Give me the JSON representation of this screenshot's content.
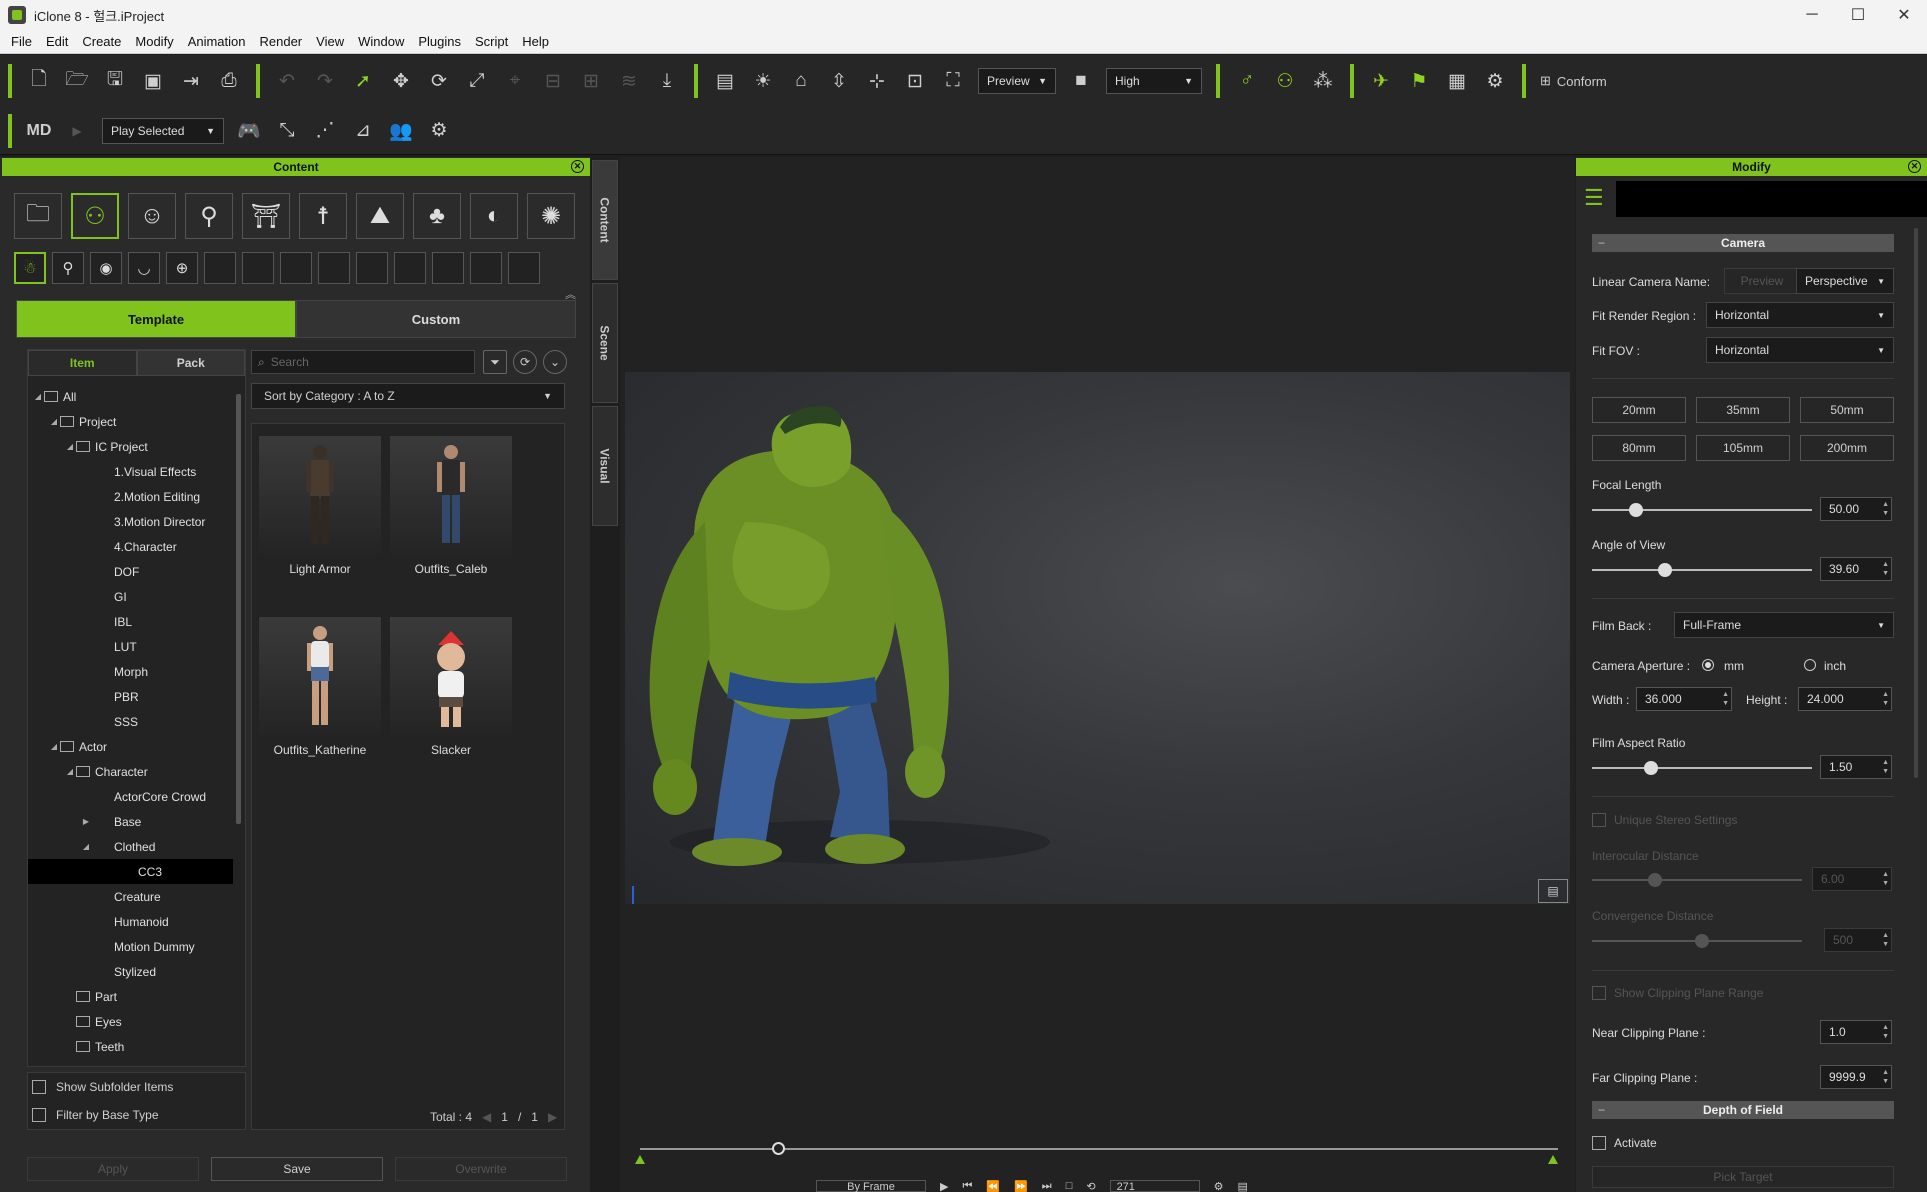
{
  "window": {
    "title": "iClone 8 - 헐크.iProject"
  },
  "menu": [
    "File",
    "Edit",
    "Create",
    "Modify",
    "Animation",
    "Render",
    "View",
    "Window",
    "Plugins",
    "Script",
    "Help"
  ],
  "toolbar": {
    "preview_mode": "Preview",
    "quality": "High",
    "conform_label": "Conform"
  },
  "toolbar2": {
    "play_mode": "Play Selected"
  },
  "content": {
    "title": "Content",
    "tabs": {
      "template": "Template",
      "custom": "Custom"
    },
    "subtabs": {
      "item": "Item",
      "pack": "Pack"
    },
    "search_placeholder": "Search",
    "sort": "Sort by Category : A to Z",
    "tree": [
      {
        "label": "All",
        "indent": 0,
        "toggle": "◢",
        "folder": true
      },
      {
        "label": "Project",
        "indent": 1,
        "toggle": "◢",
        "folder": true
      },
      {
        "label": "IC Project",
        "indent": 2,
        "toggle": "◢",
        "folder": true
      },
      {
        "label": "1.Visual Effects",
        "indent": 3
      },
      {
        "label": "2.Motion Editing",
        "indent": 3
      },
      {
        "label": "3.Motion Director",
        "indent": 3
      },
      {
        "label": "4.Character",
        "indent": 3
      },
      {
        "label": "DOF",
        "indent": 3
      },
      {
        "label": "GI",
        "indent": 3
      },
      {
        "label": "IBL",
        "indent": 3
      },
      {
        "label": "LUT",
        "indent": 3
      },
      {
        "label": "Morph",
        "indent": 3
      },
      {
        "label": "PBR",
        "indent": 3
      },
      {
        "label": "SSS",
        "indent": 3
      },
      {
        "label": "Actor",
        "indent": 1,
        "toggle": "◢",
        "folder": true
      },
      {
        "label": "Character",
        "indent": 2,
        "toggle": "◢",
        "folder": true
      },
      {
        "label": "ActorCore Crowd",
        "indent": 3
      },
      {
        "label": "Base",
        "indent": 3,
        "toggle": "▶"
      },
      {
        "label": "Clothed",
        "indent": 3,
        "toggle": "◢"
      },
      {
        "label": "CC3",
        "indent": 4,
        "selected": true
      },
      {
        "label": "Creature",
        "indent": 3
      },
      {
        "label": "Humanoid",
        "indent": 3
      },
      {
        "label": "Motion Dummy",
        "indent": 3
      },
      {
        "label": "Stylized",
        "indent": 3
      },
      {
        "label": "Part",
        "indent": 2,
        "folder": true
      },
      {
        "label": "Eyes",
        "indent": 2,
        "folder": true
      },
      {
        "label": "Teeth",
        "indent": 2,
        "folder": true
      }
    ],
    "items": [
      {
        "label": "Light Armor"
      },
      {
        "label": "Outfits_Caleb"
      },
      {
        "label": "Outfits_Katherine"
      },
      {
        "label": "Slacker"
      }
    ],
    "checks": {
      "subfolder": "Show Subfolder Items",
      "base_type": "Filter by Base Type"
    },
    "total": "Total : 4",
    "page_current": "1",
    "page_sep": "/",
    "page_total": "1",
    "buttons": {
      "apply": "Apply",
      "save": "Save",
      "overwrite": "Overwrite"
    }
  },
  "side_tabs": {
    "content": "Content",
    "scene": "Scene",
    "visual": "Visual"
  },
  "viewport": {
    "frame_mode": "By Frame",
    "frame": "271"
  },
  "modify": {
    "title": "Modify",
    "camera_section": "Camera",
    "linear_camera_name": "Linear Camera Name:",
    "preview_btn": "Preview",
    "projection": "Perspective",
    "fit_render_region_label": "Fit Render Region :",
    "fit_render_region": "Horizontal",
    "fit_fov_label": "Fit FOV :",
    "fit_fov": "Horizontal",
    "lens_buttons": [
      "20mm",
      "35mm",
      "50mm",
      "80mm",
      "105mm",
      "200mm"
    ],
    "focal_length_label": "Focal Length",
    "focal_length": "50.00",
    "focal_length_level": 0.2,
    "angle_of_view_label": "Angle of View",
    "angle_of_view": "39.60",
    "angle_of_view_level": 0.33,
    "film_back_label": "Film Back :",
    "film_back": "Full-Frame",
    "camera_aperture_label": "Camera Aperture :",
    "unit_mm": "mm",
    "unit_inch": "inch",
    "width_label": "Width :",
    "width": "36.000",
    "height_label": "Height :",
    "height": "24.000",
    "film_aspect_label": "Film Aspect Ratio",
    "film_aspect": "1.50",
    "film_aspect_level": 0.27,
    "unique_stereo": "Unique Stereo Settings",
    "interocular_label": "Interocular Distance",
    "interocular": "6.00",
    "convergence_label": "Convergence Distance",
    "convergence": "500",
    "show_clipping": "Show Clipping Plane Range",
    "near_label": "Near Clipping Plane :",
    "near": "1.0",
    "far_label": "Far Clipping Plane :",
    "far": "9999.9",
    "dof_section": "Depth of Field",
    "activate": "Activate",
    "pick_target": "Pick Target"
  },
  "colors": {
    "accent": "#7fc31c"
  }
}
